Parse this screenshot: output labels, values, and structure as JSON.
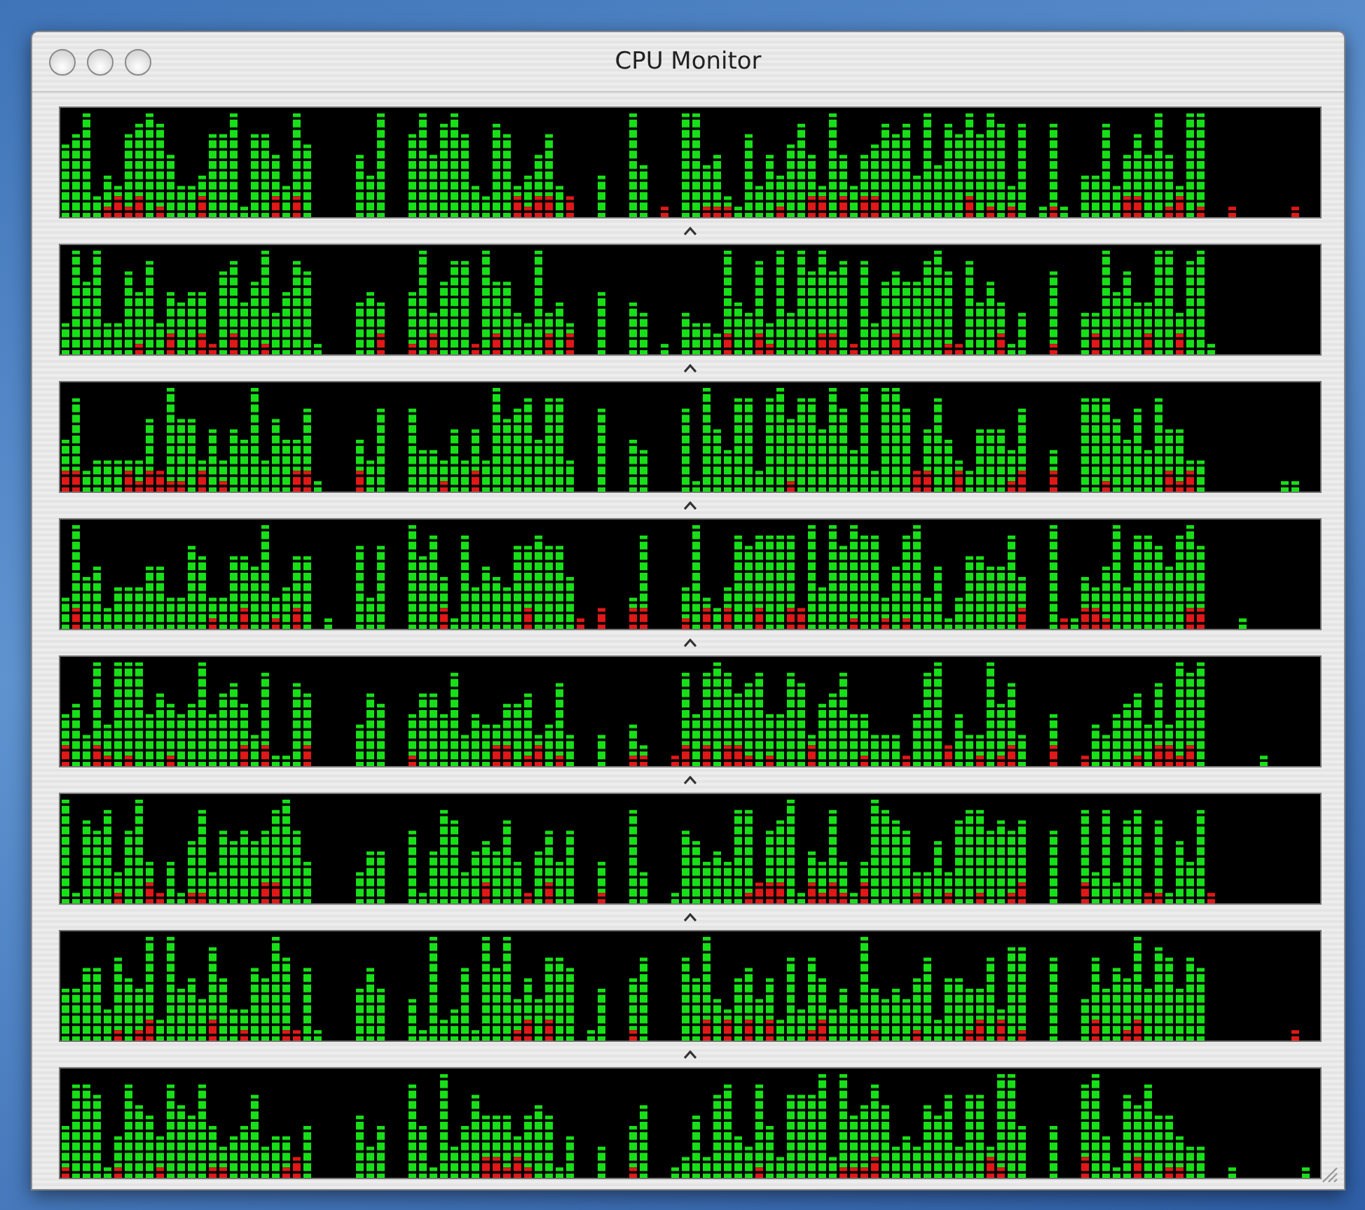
{
  "window": {
    "title": "CPU Monitor"
  },
  "meters": [
    {
      "kind": "cpu-meter"
    },
    {
      "kind": "cpu-meter"
    },
    {
      "kind": "cpu-meter"
    },
    {
      "kind": "cpu-meter"
    },
    {
      "kind": "cpu-meter"
    },
    {
      "kind": "cpu-meter"
    },
    {
      "kind": "cpu-meter"
    },
    {
      "kind": "cpu-meter"
    }
  ]
}
